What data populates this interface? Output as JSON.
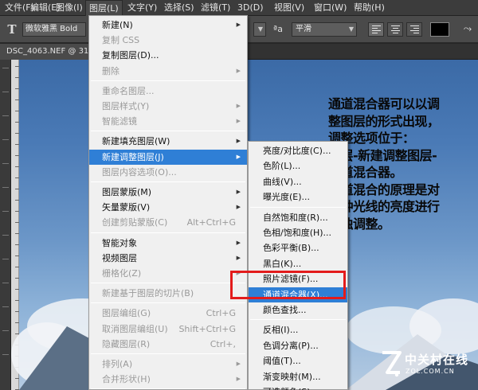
{
  "menubar": {
    "items": [
      {
        "label": "文件(F)"
      },
      {
        "label": "编辑(E)"
      },
      {
        "label": "图像(I)"
      },
      {
        "label": "图层(L)"
      },
      {
        "label": "文字(Y)"
      },
      {
        "label": "选择(S)"
      },
      {
        "label": "滤镜(T)"
      },
      {
        "label": "3D(D)"
      },
      {
        "label": "视图(V)"
      },
      {
        "label": "窗口(W)"
      },
      {
        "label": "帮助(H)"
      }
    ],
    "active_index": 3
  },
  "options_bar": {
    "tool_icon": "text-tool-icon",
    "font_family": "微软雅黑 Bold",
    "antialias_icon_text": "ªa",
    "antialias_value": "平滑",
    "text_color": "#000000",
    "warp_icon": "warp-text-icon"
  },
  "document": {
    "tab_title": "DSC_4063.NEF @ 31%"
  },
  "layer_menu": {
    "items": [
      {
        "label": "新建(N)",
        "shortcut": "",
        "submenu": true,
        "disabled": false
      },
      {
        "label": "复制 CSS",
        "shortcut": "",
        "submenu": false,
        "disabled": true
      },
      {
        "label": "复制图层(D)...",
        "shortcut": "",
        "submenu": false,
        "disabled": false
      },
      {
        "label": "删除",
        "shortcut": "",
        "submenu": true,
        "disabled": true
      },
      {
        "sep": true
      },
      {
        "label": "重命名图层...",
        "shortcut": "",
        "submenu": false,
        "disabled": true
      },
      {
        "label": "图层样式(Y)",
        "shortcut": "",
        "submenu": true,
        "disabled": true
      },
      {
        "label": "智能滤镜",
        "shortcut": "",
        "submenu": true,
        "disabled": true
      },
      {
        "sep": true
      },
      {
        "label": "新建填充图层(W)",
        "shortcut": "",
        "submenu": true,
        "disabled": false
      },
      {
        "label": "新建调整图层(J)",
        "shortcut": "",
        "submenu": true,
        "disabled": false,
        "highlighted": true
      },
      {
        "label": "图层内容选项(O)...",
        "shortcut": "",
        "submenu": false,
        "disabled": true
      },
      {
        "sep": true
      },
      {
        "label": "图层蒙版(M)",
        "shortcut": "",
        "submenu": true,
        "disabled": false
      },
      {
        "label": "矢量蒙版(V)",
        "shortcut": "",
        "submenu": true,
        "disabled": false
      },
      {
        "label": "创建剪贴蒙版(C)",
        "shortcut": "Alt+Ctrl+G",
        "submenu": false,
        "disabled": true
      },
      {
        "sep": true
      },
      {
        "label": "智能对象",
        "shortcut": "",
        "submenu": true,
        "disabled": false
      },
      {
        "label": "视频图层",
        "shortcut": "",
        "submenu": true,
        "disabled": false
      },
      {
        "label": "栅格化(Z)",
        "shortcut": "",
        "submenu": true,
        "disabled": true
      },
      {
        "sep": true
      },
      {
        "label": "新建基于图层的切片(B)",
        "shortcut": "",
        "submenu": false,
        "disabled": true
      },
      {
        "sep": true
      },
      {
        "label": "图层编组(G)",
        "shortcut": "Ctrl+G",
        "submenu": false,
        "disabled": true
      },
      {
        "label": "取消图层编组(U)",
        "shortcut": "Shift+Ctrl+G",
        "submenu": false,
        "disabled": true
      },
      {
        "label": "隐藏图层(R)",
        "shortcut": "Ctrl+,",
        "submenu": false,
        "disabled": true
      },
      {
        "sep": true
      },
      {
        "label": "排列(A)",
        "shortcut": "",
        "submenu": true,
        "disabled": true
      },
      {
        "label": "合并形状(H)",
        "shortcut": "",
        "submenu": true,
        "disabled": true
      },
      {
        "sep": true
      },
      {
        "label": "将图层与选区对齐",
        "shortcut": "",
        "submenu": true,
        "disabled": true
      }
    ]
  },
  "adjust_submenu": {
    "items": [
      {
        "label": "亮度/对比度(C)..."
      },
      {
        "label": "色阶(L)..."
      },
      {
        "label": "曲线(V)..."
      },
      {
        "label": "曝光度(E)..."
      },
      {
        "sep": true
      },
      {
        "label": "自然饱和度(R)..."
      },
      {
        "label": "色相/饱和度(H)..."
      },
      {
        "label": "色彩平衡(B)..."
      },
      {
        "label": "黑白(K)..."
      },
      {
        "label": "照片滤镜(F)..."
      },
      {
        "label": "通道混合器(X)...",
        "highlighted": true
      },
      {
        "label": "颜色查找..."
      },
      {
        "sep": true
      },
      {
        "label": "反相(I)..."
      },
      {
        "label": "色调分离(P)..."
      },
      {
        "label": "阈值(T)..."
      },
      {
        "label": "渐变映射(M)..."
      },
      {
        "label": "可选颜色(S)..."
      }
    ]
  },
  "annotation": {
    "lines": [
      "通道混合器可以以调",
      "整图层的形式出现，",
      "调整选项位于：",
      "图层-新建调整图层-",
      "通道混合器。",
      "通道混合的原理是对",
      "每种光线的亮度进行",
      "单独调整。"
    ],
    "highlight_color": "#e31b1b"
  },
  "watermark": {
    "logo_icon": "zol-z-logo-icon",
    "brand_text": "中关村在线",
    "url_text": "ZOL.COM.CN"
  },
  "colors": {
    "menu_highlight": "#2f7fd6",
    "menu_bg": "#f0f0f0",
    "menubar_bg": "#3c3c3c"
  }
}
